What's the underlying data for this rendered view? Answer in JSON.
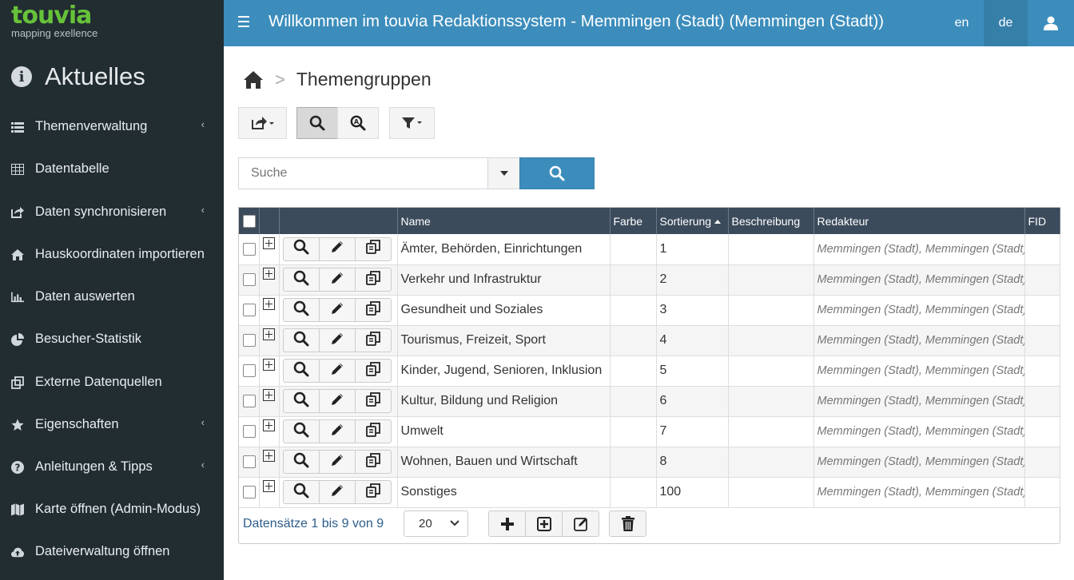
{
  "brand": {
    "name": "touvia",
    "tagline": "mapping exellence",
    "color": "#67c23a"
  },
  "sidebar": {
    "section_title": "Aktuelles",
    "items": [
      {
        "label": "Themenverwaltung",
        "icon": "list-icon",
        "has_submenu": true
      },
      {
        "label": "Datentabelle",
        "icon": "table-icon",
        "has_submenu": false
      },
      {
        "label": "Daten synchronisieren",
        "icon": "share-icon",
        "has_submenu": true
      },
      {
        "label": "Hauskoordinaten importieren",
        "icon": "home-icon",
        "has_submenu": false
      },
      {
        "label": "Daten auswerten",
        "icon": "bar-chart-icon",
        "has_submenu": false
      },
      {
        "label": "Besucher-Statistik",
        "icon": "pie-chart-icon",
        "has_submenu": false
      },
      {
        "label": "Externe Datenquellen",
        "icon": "clone-icon",
        "has_submenu": false
      },
      {
        "label": "Eigenschaften",
        "icon": "star-icon",
        "has_submenu": true
      },
      {
        "label": "Anleitungen & Tipps",
        "icon": "question-icon",
        "has_submenu": true
      },
      {
        "label": "Karte öffnen (Admin-Modus)",
        "icon": "map-icon",
        "has_submenu": false
      },
      {
        "label": "Dateiverwaltung öffnen",
        "icon": "cloud-upload-icon",
        "has_submenu": false
      }
    ],
    "chevron": "‹"
  },
  "header": {
    "title": "Willkommen im touvia Redaktionssystem - Memmingen (Stadt) (Memmingen (Stadt))",
    "lang_en": "en",
    "lang_de": "de",
    "active_lang": "de",
    "color": "#3c8dbc"
  },
  "breadcrumb": {
    "separator": ">",
    "current": "Themengruppen"
  },
  "search": {
    "placeholder": "Suche",
    "value": ""
  },
  "table": {
    "columns": {
      "name": "Name",
      "farbe": "Farbe",
      "sortierung": "Sortierung",
      "beschreibung": "Beschreibung",
      "redakteur": "Redakteur",
      "fid": "FID"
    },
    "rows": [
      {
        "name": "Ämter, Behörden, Einrichtungen",
        "sortierung": "1",
        "redakteur": "Memmingen (Stadt), Memmingen (Stadt)"
      },
      {
        "name": "Verkehr und Infrastruktur",
        "sortierung": "2",
        "redakteur": "Memmingen (Stadt), Memmingen (Stadt)"
      },
      {
        "name": "Gesundheit und Soziales",
        "sortierung": "3",
        "redakteur": "Memmingen (Stadt), Memmingen (Stadt)"
      },
      {
        "name": "Tourismus, Freizeit, Sport",
        "sortierung": "4",
        "redakteur": "Memmingen (Stadt), Memmingen (Stadt)"
      },
      {
        "name": "Kinder, Jugend, Senioren, Inklusion",
        "sortierung": "5",
        "redakteur": "Memmingen (Stadt), Memmingen (Stadt)"
      },
      {
        "name": "Kultur, Bildung und Religion",
        "sortierung": "6",
        "redakteur": "Memmingen (Stadt), Memmingen (Stadt)"
      },
      {
        "name": "Umwelt",
        "sortierung": "7",
        "redakteur": "Memmingen (Stadt), Memmingen (Stadt)"
      },
      {
        "name": "Wohnen, Bauen und Wirtschaft",
        "sortierung": "8",
        "redakteur": "Memmingen (Stadt), Memmingen (Stadt)"
      },
      {
        "name": "Sonstiges",
        "sortierung": "100",
        "redakteur": "Memmingen (Stadt), Memmingen (Stadt)"
      }
    ]
  },
  "footer": {
    "records_info": "Datensätze 1 bis 9 von 9",
    "page_size": "20"
  }
}
